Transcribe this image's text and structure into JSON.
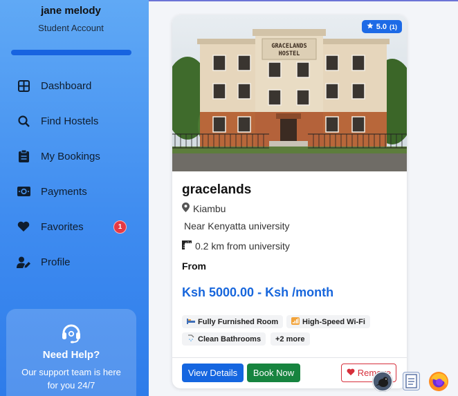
{
  "user": {
    "name": "jane melody",
    "role": "Student Account"
  },
  "nav": [
    {
      "label": "Dashboard",
      "icon": "grid-icon"
    },
    {
      "label": "Find Hostels",
      "icon": "search-icon"
    },
    {
      "label": "My Bookings",
      "icon": "clipboard-icon"
    },
    {
      "label": "Payments",
      "icon": "money-icon"
    },
    {
      "label": "Favorites",
      "icon": "heart-icon",
      "badge": "1"
    },
    {
      "label": "Profile",
      "icon": "user-edit-icon"
    }
  ],
  "help": {
    "title": "Need Help?",
    "text": "Our support team is here for you 24/7"
  },
  "hostel": {
    "name": "gracelands",
    "sign": "GRACELANDS HOSTEL",
    "rating": "5.0",
    "rating_count": "(1)",
    "location": "Kiambu",
    "near": "Near Kenyatta university",
    "distance": "0.2 km from university",
    "from_label": "From",
    "price": "Ksh 5000.00 - Ksh /month",
    "amenities": [
      "Fully Furnished Room",
      "High-Speed Wi-Fi",
      "Clean Bathrooms"
    ],
    "more": "+2 more"
  },
  "buttons": {
    "details": "View Details",
    "book": "Book Now",
    "remove": "Remove"
  },
  "colors": {
    "primary": "#1566e0",
    "success": "#17843f",
    "danger": "#d62f3b",
    "badge": "#e53945"
  }
}
